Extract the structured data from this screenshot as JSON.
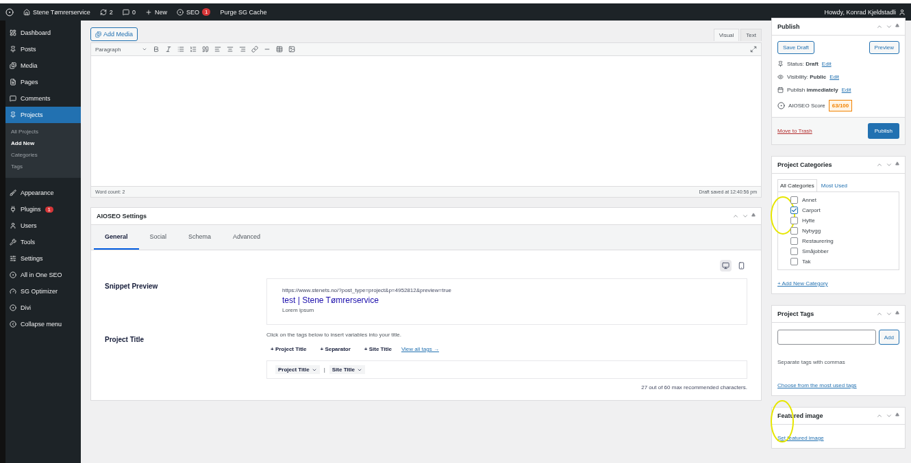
{
  "admin_bar": {
    "site_name": "Stene Tømrerservice",
    "updates": "2",
    "comments": "0",
    "new": "New",
    "seo": "SEO",
    "seo_badge": "1",
    "purge": "Purge SG Cache",
    "greeting": "Howdy, Konrad Kjeldstadli"
  },
  "sidebar": {
    "items": [
      {
        "label": "Dashboard",
        "selected": false
      },
      {
        "label": "Posts",
        "selected": false
      },
      {
        "label": "Media",
        "selected": false
      },
      {
        "label": "Pages",
        "selected": false
      },
      {
        "label": "Comments",
        "selected": false
      },
      {
        "label": "Projects",
        "selected": true,
        "children": [
          {
            "label": "All Projects",
            "selected": false
          },
          {
            "label": "Add New",
            "selected": true
          },
          {
            "label": "Categories",
            "selected": false
          },
          {
            "label": "Tags",
            "selected": false
          }
        ]
      },
      {
        "label": "Appearance",
        "selected": false
      },
      {
        "label": "Plugins",
        "selected": false,
        "badge": "1"
      },
      {
        "label": "Users",
        "selected": false
      },
      {
        "label": "Tools",
        "selected": false
      },
      {
        "label": "Settings",
        "selected": false
      },
      {
        "label": "All in One SEO",
        "selected": false
      },
      {
        "label": "SG Optimizer",
        "selected": false
      },
      {
        "label": "Divi",
        "selected": false
      },
      {
        "label": "Collapse menu",
        "selected": false
      }
    ]
  },
  "editor": {
    "add_media": "Add Media",
    "tabs": [
      {
        "label": "Visual",
        "selected": true
      },
      {
        "label": "Text",
        "selected": false
      }
    ],
    "format": "Paragraph",
    "word_count": "Word count: 2",
    "draft_saved": "Draft saved at 12:40:56 pm"
  },
  "aioseo": {
    "title": "AIOSEO Settings",
    "tabs": [
      {
        "label": "General",
        "selected": true
      },
      {
        "label": "Social",
        "selected": false
      },
      {
        "label": "Schema",
        "selected": false
      },
      {
        "label": "Advanced",
        "selected": false
      }
    ],
    "devices": [
      {
        "kind": "desktop",
        "selected": true
      },
      {
        "kind": "mobile",
        "selected": false
      }
    ],
    "snippet_label": "Snippet Preview",
    "snippet_url": "https://www.stenets.no/?post_type=project&p=4952812&preview=true",
    "snippet_title": "test | Stene Tømrerservice",
    "snippet_desc": "Lorem ipsum",
    "title_label": "Project Title",
    "title_hint": "Click on the tags below to insert variables into your title.",
    "tag_buttons": [
      "+ Project Title",
      "+ Separator",
      "+ Site Title"
    ],
    "view_all": "View all tags →",
    "title_tokens": [
      "Project Title",
      "Site Title"
    ],
    "separator": "|",
    "char_count": "27 out of 60 max recommended characters."
  },
  "publish": {
    "title": "Publish",
    "save_draft": "Save Draft",
    "preview": "Preview",
    "rows": [
      {
        "label": "Status:",
        "value": "Draft",
        "link": "Edit"
      },
      {
        "label": "Visibility:",
        "value": "Public",
        "link": "Edit"
      },
      {
        "label": "Publish",
        "value": "immediately",
        "link": "Edit"
      }
    ],
    "score_label": "AIOSEO Score",
    "score": "63/100",
    "trash": "Move to Trash",
    "publish": "Publish"
  },
  "categories": {
    "title": "Project Categories",
    "tabs": [
      {
        "label": "All Categories",
        "selected": true
      },
      {
        "label": "Most Used",
        "selected": false
      }
    ],
    "items": [
      {
        "label": "Annet",
        "checked": false
      },
      {
        "label": "Carport",
        "checked": true
      },
      {
        "label": "Hytte",
        "checked": false
      },
      {
        "label": "Nybygg",
        "checked": false
      },
      {
        "label": "Restaurering",
        "checked": false
      },
      {
        "label": "Småjobber",
        "checked": false
      },
      {
        "label": "Tak",
        "checked": false
      }
    ],
    "add_new": "+ Add New Category"
  },
  "tags": {
    "title": "Project Tags",
    "add": "Add",
    "hint": "Separate tags with commas",
    "choose": "Choose from the most used tags"
  },
  "featured": {
    "title": "Featured image",
    "link": "Set featured image"
  }
}
